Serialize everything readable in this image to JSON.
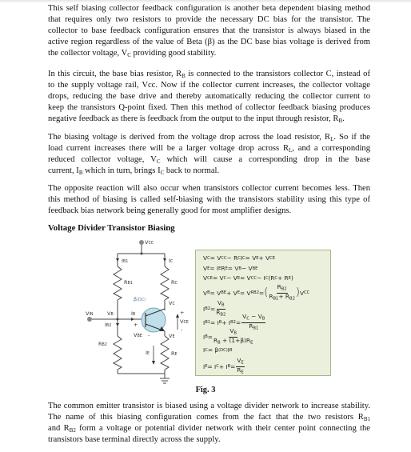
{
  "paragraphs": [
    {
      "lines": [
        [
          "This self biasing collector feedback configuration is another beta dependent biasing method"
        ],
        [
          "that requires only two resistors to provide the necessary DC bias for the transistor. The"
        ],
        [
          "collector to base feedback configuration ensures that the transistor is always biased in the"
        ],
        [
          "active region regardless of the value of Beta (β) as the DC base bias voltage is derived from"
        ],
        [
          "the collector voltage, V",
          {
            "sub": "C"
          },
          " providing good stability."
        ]
      ]
    },
    {
      "lines": [
        [
          "In this circuit, the base bias resistor, R",
          {
            "sub": "B"
          },
          " is connected to the transistors collector C, instead of"
        ],
        [
          "to the supply voltage rail, Vcc. Now if the collector current increases, the collector voltage"
        ],
        [
          "drops, reducing the base drive and thereby automatically reducing the collector current to"
        ],
        [
          "keep the transistors Q-point fixed. Then this method of collector feedback biasing produces"
        ],
        [
          "negative feedback as there is feedback from the output to the input through resistor, R",
          {
            "sub": "B"
          },
          "."
        ]
      ]
    },
    {
      "lines": [
        [
          "The biasing voltage is derived from the voltage drop across the load resistor, R",
          {
            "sub": "L"
          },
          ". So if the"
        ],
        [
          "load current increases there will be a larger voltage drop across R",
          {
            "sub": "L"
          },
          ", and a corresponding"
        ],
        [
          "reduced collector voltage, V",
          {
            "sub": "C"
          },
          " which will cause a corresponding drop in the base"
        ],
        [
          "current, I",
          {
            "sub": "B"
          },
          " which in turn, brings I",
          {
            "sub": "C"
          },
          " back to normal."
        ]
      ]
    },
    {
      "lines": [
        [
          "The opposite reaction will also occur when transistors collector current becomes less. Then"
        ],
        [
          "this method of biasing is called self-biasing with the transistors stability using this type of"
        ],
        [
          "feedback bias network being generally good for most amplifier designs."
        ]
      ]
    },
    {
      "lines": [
        [
          "The common emitter transistor is biased using a voltage divider network to increase stability."
        ],
        [
          "The name of this biasing configuration comes from the fact that the two resistors R",
          {
            "sub": "B1"
          }
        ],
        [
          "and R",
          {
            "sub": "B2"
          },
          " form a voltage or potential divider network with their center point connecting the"
        ],
        [
          "transistors base terminal directly across the supply."
        ]
      ]
    }
  ],
  "heading": "Voltage Divider Transistor Biasing",
  "figure_caption": "Fig. 3",
  "circuit": {
    "vcc": "V",
    "vcc_sub": "CC",
    "ib1": "I",
    "ib1_sub": "B1",
    "ic": "I",
    "ic_sub": "C",
    "rb1": "R",
    "rb1_sub": "B1",
    "rc": "R",
    "rc_sub": "C",
    "beta": "β",
    "beta_sub": "(DC)",
    "vc": "V",
    "vc_sub": "C",
    "vin": "V",
    "vin_sub": "IN",
    "vb": "V",
    "vb_sub": "B",
    "ib": "I",
    "ib_sub": "B",
    "vce_plus": "+",
    "vce": "V",
    "vce_sub": "CE",
    "vce_minus": "-",
    "ib2": "I",
    "ib2_sub": "B2",
    "vbe_plus": "+",
    "vbe": "V",
    "vbe_sub": "BE",
    "vbe_minus": "-",
    "ve": "V",
    "ve_sub": "E",
    "rb2": "R",
    "rb2_sub": "B2",
    "ie": "I",
    "ie_sub": "E",
    "re": "R",
    "re_sub": "E"
  },
  "equations": [
    [
      "V",
      {
        "sub": "C"
      },
      " = V",
      {
        "sub": "CC"
      },
      " − R",
      {
        "sub": "C"
      },
      "I",
      {
        "sub": "C"
      },
      " = V",
      {
        "sub": "E"
      },
      "+ V",
      {
        "sub": "CE"
      }
    ],
    [
      "V",
      {
        "sub": "E"
      },
      " = I",
      {
        "sub": "E"
      },
      "R",
      {
        "sub": "E"
      },
      " = V",
      {
        "sub": "B"
      },
      " − V",
      {
        "sub": "BE"
      }
    ],
    [
      "V",
      {
        "sub": "CE"
      },
      " = V",
      {
        "sub": "C"
      },
      " − V",
      {
        "sub": "E"
      },
      " = V",
      {
        "sub": "CC"
      },
      " − I",
      {
        "sub": "C"
      },
      "(R",
      {
        "sub": "C"
      },
      "+ R",
      {
        "sub": "E"
      },
      ")"
    ],
    [
      "V",
      {
        "sub": "B"
      },
      " = V",
      {
        "sub": "BE"
      },
      " + V",
      {
        "sub": "E"
      },
      " = V",
      {
        "sub": "RB2"
      },
      " = ",
      {
        "paren": "("
      },
      {
        "frac": [
          [
            "R",
            {
              "sub": "B2"
            }
          ],
          [
            "R",
            {
              "sub": "B1"
            },
            "+ R",
            {
              "sub": "B2"
            }
          ]
        ]
      },
      {
        "paren": ")"
      },
      "V",
      {
        "sub": "CC"
      }
    ],
    [
      "I",
      {
        "sub": "B2"
      },
      " = ",
      {
        "frac": [
          [
            "V",
            {
              "sub": "B"
            }
          ],
          [
            "R",
            {
              "sub": "B2"
            }
          ]
        ]
      }
    ],
    [
      "I",
      {
        "sub": "B1"
      },
      " = I",
      {
        "sub": "B"
      },
      " + I",
      {
        "sub": "B2"
      },
      " = ",
      {
        "frac": [
          [
            "V",
            {
              "sub": "C"
            },
            " − V",
            {
              "sub": "B"
            }
          ],
          [
            "R",
            {
              "sub": "B1"
            }
          ]
        ]
      }
    ],
    [
      "I",
      {
        "sub": "B"
      },
      " = ",
      {
        "frac": [
          [
            "V",
            {
              "sub": "B"
            }
          ],
          [
            "R",
            {
              "sub": "B"
            },
            " + (1+β)R",
            {
              "sub": "E"
            }
          ]
        ]
      }
    ],
    [
      "I",
      {
        "sub": "C"
      },
      " = β",
      {
        "sub": "(DC)"
      },
      "I",
      {
        "sub": "B"
      }
    ],
    [
      "I",
      {
        "sub": "E"
      },
      " = I",
      {
        "sub": "C"
      },
      "+ I",
      {
        "sub": "B"
      },
      " = ",
      {
        "frac": [
          [
            "V",
            {
              "sub": "E"
            }
          ],
          [
            "R",
            {
              "sub": "E"
            }
          ]
        ]
      }
    ]
  ],
  "colors": {
    "eq_box_fill": "#eaf0dc",
    "eq_box_border": "#a7b888",
    "transistor_fill": "#bfe0ea"
  }
}
